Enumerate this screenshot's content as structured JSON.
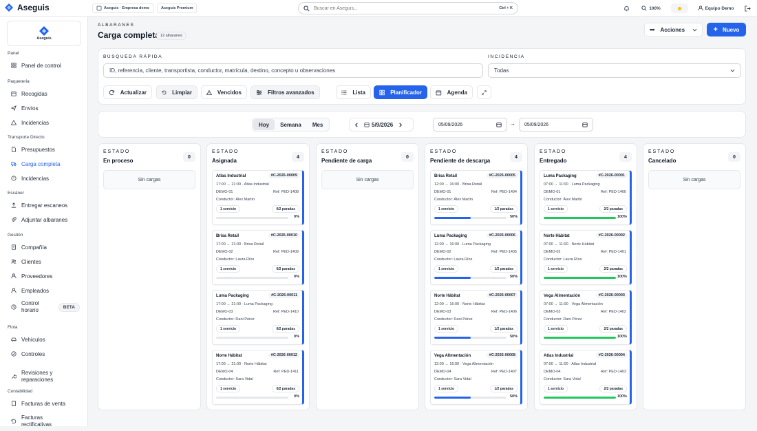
{
  "topbar": {
    "brand": "Aseguis",
    "workspace": "Aseguis · Empresa demo",
    "plan": "Aseguis Premium",
    "search_placeholder": "Buscar en Aseguis...",
    "shortcut": "Ctrl + K",
    "zoom": "100%",
    "user": "Equipo Demo"
  },
  "sidebar": {
    "logo_text": "Aseguis",
    "sections": [
      {
        "title": "Panel",
        "items": [
          {
            "label": "Panel de control",
            "icon": "dashboard-icon"
          }
        ]
      },
      {
        "title": "Paquetería",
        "items": [
          {
            "label": "Recogidas",
            "icon": "package-icon"
          },
          {
            "label": "Envíos",
            "icon": "send-icon"
          },
          {
            "label": "Incidencias",
            "icon": "warning-icon"
          }
        ]
      },
      {
        "title": "Transporte Directo",
        "items": [
          {
            "label": "Presupuestos",
            "icon": "document-icon"
          },
          {
            "label": "Carga completa",
            "icon": "truck-icon",
            "active": true
          },
          {
            "label": "Incidencias",
            "icon": "alert-icon"
          }
        ]
      },
      {
        "title": "Escáner",
        "items": [
          {
            "label": "Entregar escaneos",
            "icon": "upload-icon"
          },
          {
            "label": "Adjuntar albaranes",
            "icon": "attach-icon"
          }
        ]
      },
      {
        "title": "Gestión",
        "items": [
          {
            "label": "Compañía",
            "icon": "building-icon"
          },
          {
            "label": "Clientes",
            "icon": "users-icon"
          },
          {
            "label": "Proveedores",
            "icon": "supplier-icon"
          },
          {
            "label": "Empleados",
            "icon": "employee-icon"
          },
          {
            "label": "Control horario",
            "icon": "clock-icon",
            "badge": "BETA"
          }
        ]
      },
      {
        "title": "Flota",
        "items": [
          {
            "label": "Vehículos",
            "icon": "car-icon"
          },
          {
            "label": "Controles",
            "icon": "checklist-icon"
          },
          {
            "label": "Revisiones y reparaciones",
            "icon": "wrench-icon"
          }
        ]
      },
      {
        "title": "Contabilidad",
        "items": [
          {
            "label": "Facturas de venta",
            "icon": "invoice-icon"
          },
          {
            "label": "Facturas rectificativas",
            "icon": "refund-icon"
          }
        ]
      }
    ]
  },
  "header": {
    "breadcrumb": "ALBARANES",
    "title": "Carga completa",
    "count": "12 albaranes",
    "actions": "Acciones",
    "new": "Nuevo"
  },
  "filters": {
    "quick_label": "BÚSQUEDA RÁPIDA",
    "quick_placeholder": "ID, referencia, cliente, transportista, conductor, matrícula, destino, concepto u observaciones",
    "incident_label": "INCIDENCIA",
    "incident_value": "Todas",
    "buttons": {
      "refresh": "Actualizar",
      "clear": "Limpiar",
      "overdue": "Vencidos",
      "advanced": "Filtros avanzados"
    },
    "views": {
      "list": "Lista",
      "planner": "Planificador",
      "agenda": "Agenda"
    }
  },
  "planner": {
    "ranges": [
      "Hoy",
      "Semana",
      "Mes"
    ],
    "selected_range": "Hoy",
    "current_date": "5/9/2026",
    "date_from": "05/09/2026",
    "date_to": "05/09/2026"
  },
  "colors": {
    "accent": "#2563eb",
    "success": "#22c55e"
  },
  "columns": [
    {
      "state_label": "ESTADO",
      "name": "En proceso",
      "count": "0",
      "empty": "Sin cargas",
      "cards": []
    },
    {
      "state_label": "ESTADO",
      "name": "Asignada",
      "count": "4",
      "cards": [
        {
          "client": "Atlas Industrial",
          "id": "#C-2026-00009",
          "time": "17:00 → 21:00 · Atlas Industrial",
          "demo": "DEMO-01",
          "ref": "Ref: PED-1408",
          "driver": "Conductor: Álex Martín",
          "service": "1 servicio",
          "stops": "0/2 paradas",
          "progress": 0,
          "pct": "0%"
        },
        {
          "client": "Brisa Retail",
          "id": "#C-2026-00010",
          "time": "17:00 → 21:00 · Brisa Retail",
          "demo": "DEMO-02",
          "ref": "Ref: PED-1409",
          "driver": "Conductor: Laura Ríos",
          "service": "1 servicio",
          "stops": "0/2 paradas",
          "progress": 0,
          "pct": "0%"
        },
        {
          "client": "Luma Packaging",
          "id": "#C-2026-00011",
          "time": "17:00 → 21:00 · Luma Packaging",
          "demo": "DEMO-03",
          "ref": "Ref: PED-1410",
          "driver": "Conductor: Dani Pérez",
          "service": "1 servicio",
          "stops": "0/2 paradas",
          "progress": 0,
          "pct": "0%"
        },
        {
          "client": "Norte Hábitat",
          "id": "#C-2026-00012",
          "time": "17:00 → 21:00 · Norte Hábitat",
          "demo": "DEMO-04",
          "ref": "Ref: PED-1411",
          "driver": "Conductor: Sara Vidal",
          "service": "1 servicio",
          "stops": "0/2 paradas",
          "progress": 0,
          "pct": "0%"
        }
      ]
    },
    {
      "state_label": "ESTADO",
      "name": "Pendiente de carga",
      "count": "0",
      "empty": "Sin cargas",
      "cards": []
    },
    {
      "state_label": "ESTADO",
      "name": "Pendiente de descarga",
      "count": "4",
      "cards": [
        {
          "client": "Brisa Retail",
          "id": "#C-2026-00005",
          "time": "12:00 → 16:00 · Brisa Retail",
          "demo": "DEMO-01",
          "ref": "Ref: PED-1404",
          "driver": "Conductor: Álex Martín",
          "service": "1 servicio",
          "stops": "1/2 paradas",
          "progress": 50,
          "pct": "50%"
        },
        {
          "client": "Luma Packaging",
          "id": "#C-2026-00006",
          "time": "12:00 → 16:00 · Luma Packaging",
          "demo": "DEMO-02",
          "ref": "Ref: PED-1405",
          "driver": "Conductor: Laura Ríos",
          "service": "1 servicio",
          "stops": "1/2 paradas",
          "progress": 50,
          "pct": "50%"
        },
        {
          "client": "Norte Hábitat",
          "id": "#C-2026-00007",
          "time": "12:00 → 16:00 · Norte Hábitat",
          "demo": "DEMO-03",
          "ref": "Ref: PED-1406",
          "driver": "Conductor: Dani Pérez",
          "service": "1 servicio",
          "stops": "1/2 paradas",
          "progress": 50,
          "pct": "50%"
        },
        {
          "client": "Vega Alimentación",
          "id": "#C-2026-00008",
          "time": "12:00 → 16:00 · Vega Alimentación",
          "demo": "DEMO-04",
          "ref": "Ref: PED-1407",
          "driver": "Conductor: Sara Vidal",
          "service": "1 servicio",
          "stops": "1/2 paradas",
          "progress": 50,
          "pct": "50%"
        }
      ]
    },
    {
      "state_label": "ESTADO",
      "name": "Entregado",
      "count": "4",
      "cards": [
        {
          "client": "Luma Packaging",
          "id": "#C-2026-00001",
          "time": "07:00 → 11:00 · Luma Packaging",
          "demo": "DEMO-01",
          "ref": "Ref: PED-1400",
          "driver": "Conductor: Álex Martín",
          "service": "1 servicio",
          "stops": "2/2 paradas",
          "progress": 100,
          "pct": "100%"
        },
        {
          "client": "Norte Hábitat",
          "id": "#C-2026-00002",
          "time": "07:00 → 11:00 · Norte Hábitat",
          "demo": "DEMO-02",
          "ref": "Ref: PED-1401",
          "driver": "Conductor: Laura Ríos",
          "service": "1 servicio",
          "stops": "2/2 paradas",
          "progress": 100,
          "pct": "100%"
        },
        {
          "client": "Vega Alimentación",
          "id": "#C-2026-00003",
          "time": "07:00 → 11:00 · Vega Alimentación",
          "demo": "DEMO-03",
          "ref": "Ref: PED-1402",
          "driver": "Conductor: Dani Pérez",
          "service": "1 servicio",
          "stops": "2/2 paradas",
          "progress": 100,
          "pct": "100%"
        },
        {
          "client": "Atlas Industrial",
          "id": "#C-2026-00004",
          "time": "07:00 → 11:00 · Atlas Industrial",
          "demo": "DEMO-04",
          "ref": "Ref: PED-1403",
          "driver": "Conductor: Sara Vidal",
          "service": "1 servicio",
          "stops": "2/2 paradas",
          "progress": 100,
          "pct": "100%"
        }
      ]
    },
    {
      "state_label": "ESTADO",
      "name": "Cancelado",
      "count": "0",
      "empty": "Sin cargas",
      "cards": []
    }
  ]
}
